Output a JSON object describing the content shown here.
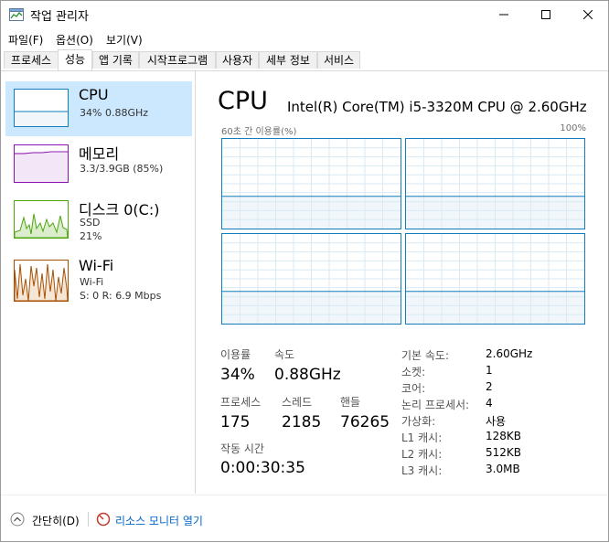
{
  "window": {
    "title": "작업 관리자",
    "minimize_icon": "minimize-icon",
    "maximize_icon": "maximize-icon",
    "close_icon": "close-icon"
  },
  "menu": [
    "파일(F)",
    "옵션(O)",
    "보기(V)"
  ],
  "tabs": [
    "프로세스",
    "성능",
    "앱 기록",
    "시작프로그램",
    "사용자",
    "세부 정보",
    "서비스"
  ],
  "active_tab": "성능",
  "sidebar": {
    "items": [
      {
        "name": "CPU",
        "line1": "34% 0.88GHz",
        "line2": "",
        "selected": true,
        "color": "#117dbb"
      },
      {
        "name": "메모리",
        "line1": "3.3/3.9GB (85%)",
        "line2": "",
        "selected": false,
        "color": "#8b12ae"
      },
      {
        "name": "디스크 0(C:)",
        "line1": "SSD",
        "line2": "21%",
        "selected": false,
        "color": "#4da60c"
      },
      {
        "name": "Wi-Fi",
        "line1": "Wi-Fi",
        "line2": "S: 0 R: 6.9 Mbps",
        "selected": false,
        "color": "#a74f01"
      }
    ]
  },
  "main": {
    "title": "CPU",
    "model": "Intel(R) Core(TM) i5-3320M CPU @ 2.60GHz",
    "graph_label": "60초 간 이용률(%)",
    "graph_max": "100%",
    "stats": {
      "util_label": "이용률",
      "util_value": "34%",
      "speed_label": "속도",
      "speed_value": "0.88GHz",
      "proc_label": "프로세스",
      "proc_value": "175",
      "thread_label": "스레드",
      "thread_value": "2185",
      "handle_label": "핸들",
      "handle_value": "76265",
      "uptime_label": "작동 시간",
      "uptime_value": "0:00:30:35"
    },
    "info": [
      {
        "label": "기본 속도:",
        "value": "2.60GHz"
      },
      {
        "label": "소켓:",
        "value": "1"
      },
      {
        "label": "코어:",
        "value": "2"
      },
      {
        "label": "논리 프로세서:",
        "value": "4"
      },
      {
        "label": "가상화:",
        "value": "사용"
      },
      {
        "label": "L1 캐시:",
        "value": "128KB"
      },
      {
        "label": "L2 캐시:",
        "value": "512KB"
      },
      {
        "label": "L3 캐시:",
        "value": "3.0MB"
      }
    ]
  },
  "footer": {
    "fewer_details": "간단히(D)",
    "resource_monitor": "리소스 모니터 열기"
  },
  "colors": {
    "accent": "#117dbb",
    "selected_bg": "#cce8ff",
    "link": "#0066cc"
  }
}
